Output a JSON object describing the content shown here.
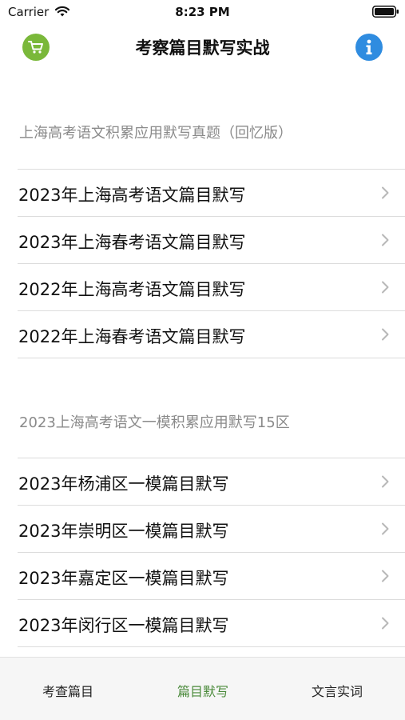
{
  "status_bar": {
    "carrier": "Carrier",
    "time": "8:23 PM"
  },
  "nav": {
    "title": "考察篇目默写实战",
    "left_icon": "cart-icon",
    "right_icon": "info-icon",
    "left_color": "#7ab83a",
    "right_color": "#2f8ce0"
  },
  "sections": [
    {
      "header": "上海高考语文积累应用默写真题（回忆版）",
      "items": [
        {
          "label": "2023年上海高考语文篇目默写"
        },
        {
          "label": "2023年上海春考语文篇目默写"
        },
        {
          "label": "2022年上海高考语文篇目默写"
        },
        {
          "label": "2022年上海春考语文篇目默写"
        }
      ]
    },
    {
      "header": "2023上海高考语文一模积累应用默写15区",
      "items": [
        {
          "label": "2023年杨浦区一模篇目默写"
        },
        {
          "label": "2023年崇明区一模篇目默写"
        },
        {
          "label": "2023年嘉定区一模篇目默写"
        },
        {
          "label": "2023年闵行区一模篇目默写"
        }
      ]
    }
  ],
  "tabs": [
    {
      "label": "考查篇目",
      "active": false
    },
    {
      "label": "篇目默写",
      "active": true
    },
    {
      "label": "文言实词",
      "active": false
    }
  ],
  "colors": {
    "active_tab": "#4a8a3a",
    "section_header": "#8a8a8a"
  }
}
